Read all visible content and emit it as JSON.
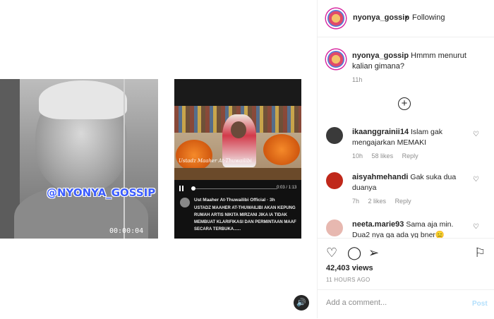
{
  "video": {
    "watermark": "@NYONYA_GOSSIP",
    "timecode": "00:00:04",
    "embedded": {
      "label": "Ustadz Maaher At-Thuwailibi",
      "time": "0:03 / 1:13",
      "caption_head": "Ust Maaher At-Thuwailibi Official · 3h",
      "caption_body": "USTADZ MAAHER AT-THUWAILIBI AKAN KEPUNG RUMAH ARTIS NIKITA MIRZANI JIKA IA TIDAK MEMBUAT KLARIFIKASI DAN PERMINTAAN MAAF SECARA TERBUKA......"
    },
    "sound_icon": "speaker-icon"
  },
  "header": {
    "username": "nyonya_gossip",
    "separator": "•",
    "follow_status": "Following"
  },
  "caption": {
    "username": "nyonya_gossip",
    "text": "Hmmm menurut kalian gimana?",
    "time": "11h"
  },
  "load_more_icon": "plus-circle-icon",
  "comments": [
    {
      "username": "ikaanggrainii14",
      "text": "Islam gak mengajarkan MEMAKI",
      "time": "10h",
      "likes": "58 likes",
      "reply": "Reply",
      "avatar_color": "#3a3a3a"
    },
    {
      "username": "aisyahmehandi",
      "text": "Gak suka dua duanya",
      "time": "7h",
      "likes": "2 likes",
      "reply": "Reply",
      "avatar_color": "#c0281a"
    },
    {
      "username": "neeta.marie93",
      "text": "Sama aja min. Dua2 nya ga ada yg bner😑",
      "avatar_color": "#e7b8b0"
    }
  ],
  "actions": {
    "like_icon": "heart-icon",
    "comment_icon": "comment-icon",
    "share_icon": "paper-plane-icon",
    "save_icon": "bookmark-icon",
    "views": "42,403 views",
    "age": "11 HOURS AGO"
  },
  "add_comment": {
    "placeholder": "Add a comment...",
    "post_label": "Post"
  }
}
